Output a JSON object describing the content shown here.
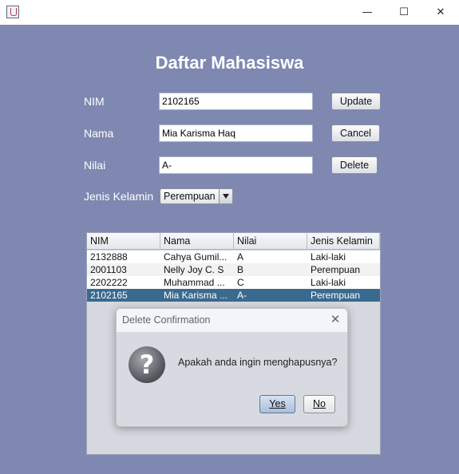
{
  "window": {
    "minimize_glyph": "—",
    "maximize_glyph": "☐",
    "close_glyph": "✕"
  },
  "form": {
    "heading": "Daftar Mahasiswa",
    "nim_label": "NIM",
    "nim_value": "2102165",
    "nama_label": "Nama",
    "nama_value": "Mia Karisma Haq",
    "nilai_label": "Nilai",
    "nilai_value": "A-",
    "jenis_label": "Jenis Kelamin",
    "jenis_value": "Perempuan",
    "update_label": "Update",
    "cancel_label": "Cancel",
    "delete_label": "Delete"
  },
  "table": {
    "columns": [
      "NIM",
      "Nama",
      "Nilai",
      "Jenis Kelamin"
    ],
    "rows": [
      [
        "2132888",
        "Cahya Gumil...",
        "A",
        "Laki-laki"
      ],
      [
        "2001103",
        "Nelly Joy C. S",
        "B",
        "Perempuan"
      ],
      [
        "2202222",
        "Muhammad ...",
        "C",
        "Laki-laki"
      ],
      [
        "2102165",
        "Mia Karisma ...",
        "A-",
        "Perempuan"
      ]
    ],
    "selected_row": 3
  },
  "dialog": {
    "title": "Delete Confirmation",
    "close_glyph": "✕",
    "icon_glyph": "?",
    "message": "Apakah anda ingin menghapusnya?",
    "yes_label": "Yes",
    "no_label": "No"
  },
  "colors": {
    "background": "#7f88b1",
    "selection": "#3a6a8e"
  }
}
